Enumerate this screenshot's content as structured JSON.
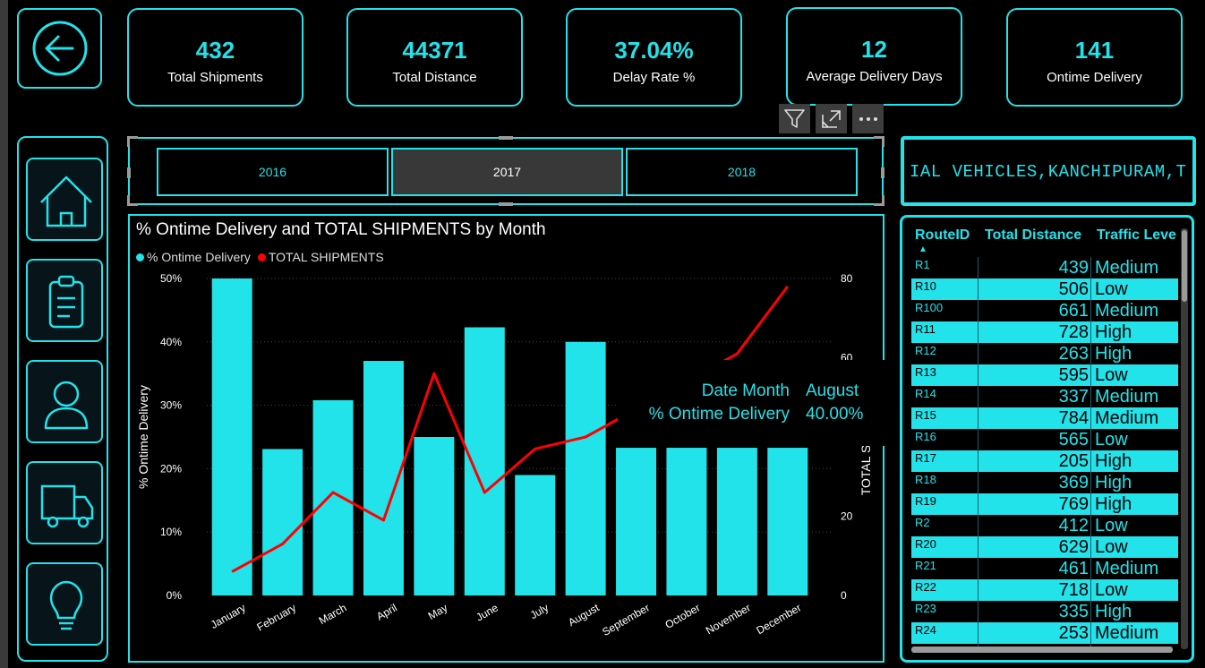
{
  "kpis": [
    {
      "value": "432",
      "label": "Total Shipments"
    },
    {
      "value": "44371",
      "label": "Total Distance"
    },
    {
      "value": "37.04%",
      "label": "Delay Rate %"
    },
    {
      "value": "12",
      "label": "Average Delivery Days"
    },
    {
      "value": "141",
      "label": "Ontime Delivery"
    }
  ],
  "nav_icons": [
    "home-icon",
    "clipboard-icon",
    "user-icon",
    "truck-icon",
    "lightbulb-icon"
  ],
  "toolbar_icons": [
    "filter-icon",
    "focus-mode-icon",
    "more-options-icon"
  ],
  "slicer": {
    "years": [
      {
        "label": "2016",
        "selected": false
      },
      {
        "label": "2017",
        "selected": true
      },
      {
        "label": "2018",
        "selected": false
      }
    ]
  },
  "ticker": {
    "text": "IAL VEHICLES,KANCHIPURAM,T"
  },
  "chart_title": "% Ontime Delivery and TOTAL SHIPMENTS by Month",
  "legend": [
    {
      "label": "% Ontime Delivery",
      "color": "#22e2ea"
    },
    {
      "label": "TOTAL SHIPMENTS",
      "color": "#ff0000"
    }
  ],
  "tooltip": {
    "row1_label": "Date Month",
    "row1_value": "August",
    "row2_label": "% Ontime Delivery",
    "row2_value": "40.00%"
  },
  "chart_data": {
    "type": "bar",
    "categories": [
      "January",
      "February",
      "March",
      "April",
      "May",
      "June",
      "July",
      "August",
      "September",
      "October",
      "November",
      "December"
    ],
    "series": [
      {
        "name": "% Ontime Delivery",
        "axis": "left",
        "type": "bar",
        "color": "#22e2ea",
        "values": [
          50,
          23.1,
          30.8,
          37,
          25,
          42.3,
          19,
          40,
          23.3,
          23.3,
          23.3,
          23.3
        ]
      },
      {
        "name": "TOTAL SHIPMENTS",
        "axis": "right",
        "type": "line",
        "color": "#ff0000",
        "values": [
          6,
          13,
          26,
          19,
          56,
          26,
          37,
          40,
          47,
          54,
          61,
          78
        ]
      }
    ],
    "ylabel": "% Ontime Delivery",
    "y2label": "TOTAL S",
    "ylim": [
      0,
      50
    ],
    "y2lim": [
      0,
      80
    ],
    "yticks": [
      "0%",
      "10%",
      "20%",
      "30%",
      "40%",
      "50%"
    ],
    "y2ticks": [
      "0",
      "20",
      "60",
      "80"
    ],
    "grid": true
  },
  "table": {
    "columns": [
      "RouteID",
      "Total Distance",
      "Traffic Leve"
    ],
    "rows": [
      [
        "R1",
        "439",
        "Medium"
      ],
      [
        "R10",
        "506",
        "Low"
      ],
      [
        "R100",
        "661",
        "Medium"
      ],
      [
        "R11",
        "728",
        "High"
      ],
      [
        "R12",
        "263",
        "High"
      ],
      [
        "R13",
        "595",
        "Low"
      ],
      [
        "R14",
        "337",
        "Medium"
      ],
      [
        "R15",
        "784",
        "Medium"
      ],
      [
        "R16",
        "565",
        "Low"
      ],
      [
        "R17",
        "205",
        "High"
      ],
      [
        "R18",
        "369",
        "High"
      ],
      [
        "R19",
        "769",
        "High"
      ],
      [
        "R2",
        "412",
        "Low"
      ],
      [
        "R20",
        "629",
        "Low"
      ],
      [
        "R21",
        "461",
        "Medium"
      ],
      [
        "R22",
        "718",
        "Low"
      ],
      [
        "R23",
        "335",
        "High"
      ],
      [
        "R24",
        "253",
        "Medium"
      ]
    ]
  },
  "colors": {
    "accent": "#22e2ea",
    "line": "#ff0000",
    "background": "#000000"
  }
}
